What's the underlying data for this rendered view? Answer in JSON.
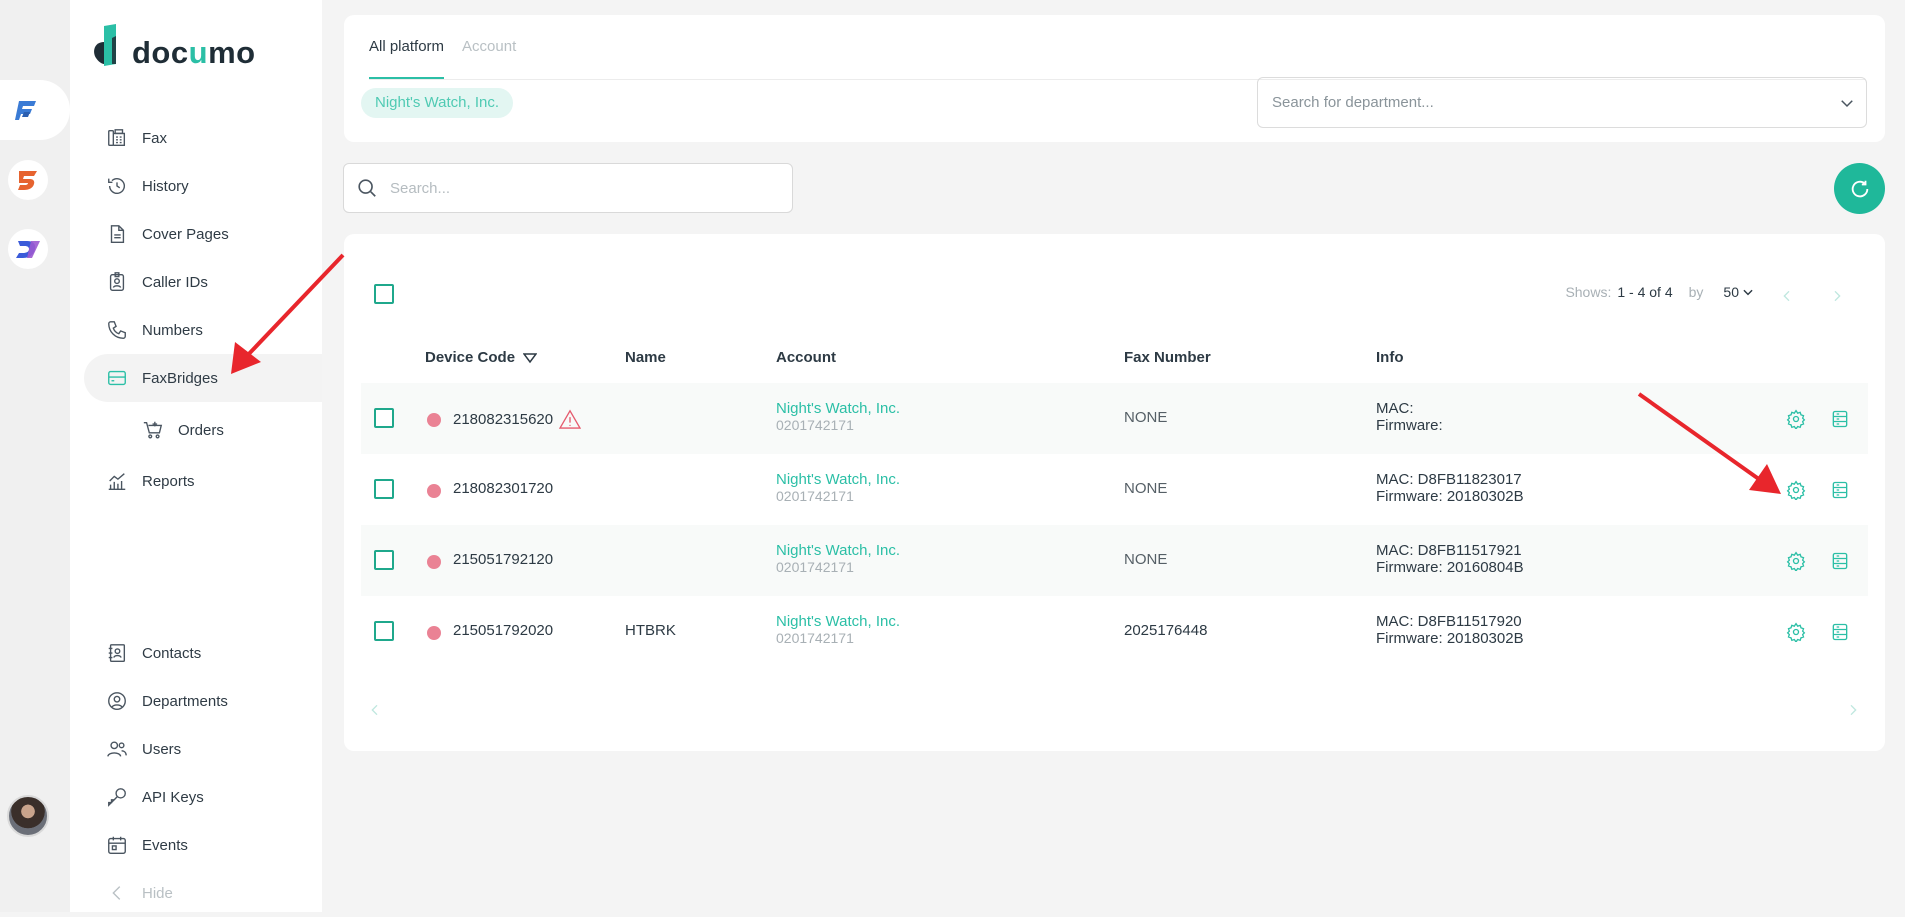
{
  "brand": {
    "logo_text_a": "doc",
    "logo_text_b": "u",
    "logo_text_c": "mo",
    "accent": "#2bbfa6"
  },
  "sidebar": {
    "items": [
      {
        "label": "Fax",
        "icon": "fax-icon"
      },
      {
        "label": "History",
        "icon": "history-icon"
      },
      {
        "label": "Cover Pages",
        "icon": "document-icon"
      },
      {
        "label": "Caller IDs",
        "icon": "id-badge-icon"
      },
      {
        "label": "Numbers",
        "icon": "phone-icon"
      },
      {
        "label": "FaxBridges",
        "icon": "faxbridge-icon",
        "active": true
      },
      {
        "label": "Orders",
        "icon": "cart-icon",
        "sub": true
      },
      {
        "label": "Reports",
        "icon": "chart-icon"
      }
    ],
    "bottom_items": [
      {
        "label": "Contacts",
        "icon": "contacts-icon"
      },
      {
        "label": "Departments",
        "icon": "departments-icon"
      },
      {
        "label": "Users",
        "icon": "users-icon"
      },
      {
        "label": "API Keys",
        "icon": "key-icon"
      },
      {
        "label": "Events",
        "icon": "calendar-icon"
      }
    ],
    "hide_label": "Hide"
  },
  "filters": {
    "tabs": [
      "All platform",
      "Account"
    ],
    "chip": "Night's Watch, Inc.",
    "department_placeholder": "Search for department..."
  },
  "search": {
    "placeholder": "Search..."
  },
  "pagination": {
    "shows_label": "Shows:",
    "range": "1 - 4 of 4",
    "by_label": "by",
    "per_page": "50"
  },
  "table": {
    "columns": [
      "Device Code",
      "Name",
      "Account",
      "Fax Number",
      "Info"
    ],
    "rows": [
      {
        "device_code": "218082315620",
        "warning": true,
        "name": "",
        "account_name": "Night's Watch, Inc.",
        "account_number": "0201742171",
        "fax_number": "NONE",
        "fax_is_link": false,
        "mac": "MAC:",
        "firmware": "Firmware:"
      },
      {
        "device_code": "218082301720",
        "warning": false,
        "name": "",
        "account_name": "Night's Watch, Inc.",
        "account_number": "0201742171",
        "fax_number": "NONE",
        "fax_is_link": false,
        "mac": "MAC: D8FB11823017",
        "firmware": "Firmware: 20180302B"
      },
      {
        "device_code": "215051792120",
        "warning": false,
        "name": "",
        "account_name": "Night's Watch, Inc.",
        "account_number": "0201742171",
        "fax_number": "NONE",
        "fax_is_link": false,
        "mac": "MAC: D8FB11517921",
        "firmware": "Firmware: 20160804B"
      },
      {
        "device_code": "215051792020",
        "warning": false,
        "name": "HTBRK",
        "account_name": "Night's Watch, Inc.",
        "account_number": "0201742171",
        "fax_number": "2025176448",
        "fax_is_link": true,
        "mac": "MAC: D8FB11517920",
        "firmware": "Firmware: 20180302B"
      }
    ]
  }
}
